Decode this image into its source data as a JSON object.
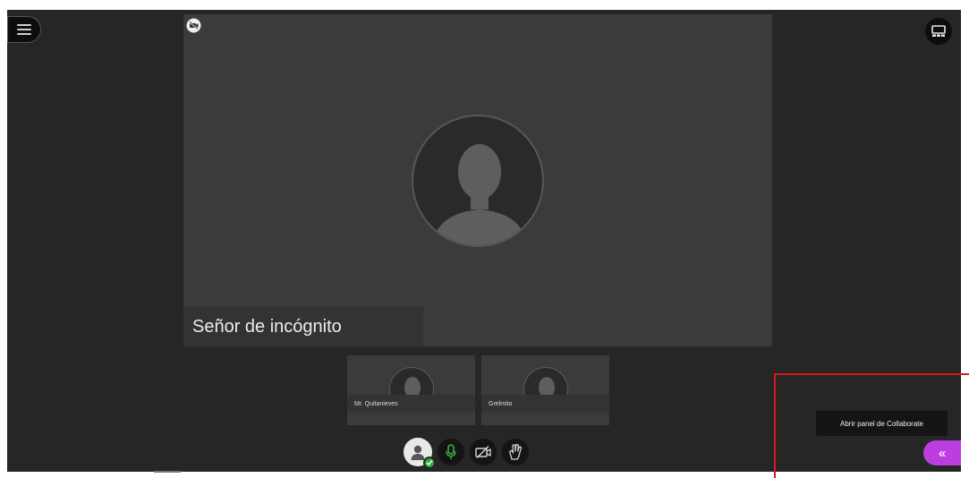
{
  "main_participant": {
    "name": "Señor de incógnito"
  },
  "thumbnails": [
    {
      "name": "Mr. Quitanieves"
    },
    {
      "name": "Grelmito"
    }
  ],
  "tooltip": {
    "text": "Abrir panel de Collaborate"
  },
  "panel_toggle": {
    "glyph": "«"
  },
  "colors": {
    "stage": "#262626",
    "tile": "#3b3b3b",
    "accent_purple": "#bb3fe0",
    "mic_green": "#3fae49",
    "status_green": "#2bb43f",
    "highlight_red": "#d81a1a"
  },
  "icons": {
    "menu": "menu-icon",
    "layout": "layout-icon",
    "camera_off_badge": "camera-off-icon",
    "profile": "profile-icon",
    "microphone": "microphone-icon",
    "camera": "camera-off-icon",
    "raise_hand": "raise-hand-icon"
  }
}
